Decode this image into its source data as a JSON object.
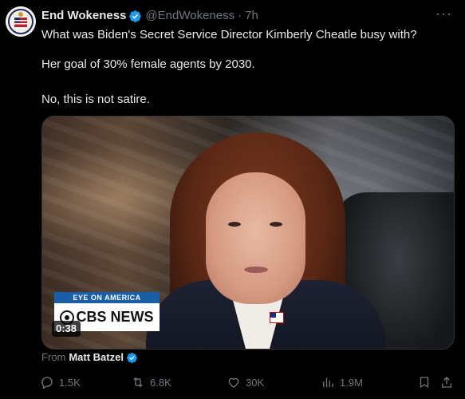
{
  "author": {
    "name": "End Wokeness",
    "handle": "@EndWokeness",
    "time": "7h"
  },
  "tweet": {
    "line1": "What was Biden's Secret Service Director Kimberly Cheatle busy with?",
    "line2": "Her goal of 30% female agents by 2030.",
    "line3": "No, this is not satire."
  },
  "video": {
    "eye_on_america": "EYE ON AMERICA",
    "network": "CBS NEWS",
    "duration": "0:38"
  },
  "source": {
    "prefix": "From",
    "author": "Matt Batzel"
  },
  "actions": {
    "replies": "1.5K",
    "reposts": "6.8K",
    "likes": "30K",
    "views": "1.9M"
  },
  "icons": {
    "verified": "verified-badge-icon",
    "more": "more-icon",
    "reply": "reply-icon",
    "repost": "repost-icon",
    "like": "heart-icon",
    "views": "views-icon",
    "bookmark": "bookmark-icon",
    "share": "share-icon"
  },
  "colors": {
    "verified": "#1d9bf0",
    "muted": "#71767b",
    "text": "#e7e9ea",
    "background": "#000000"
  }
}
